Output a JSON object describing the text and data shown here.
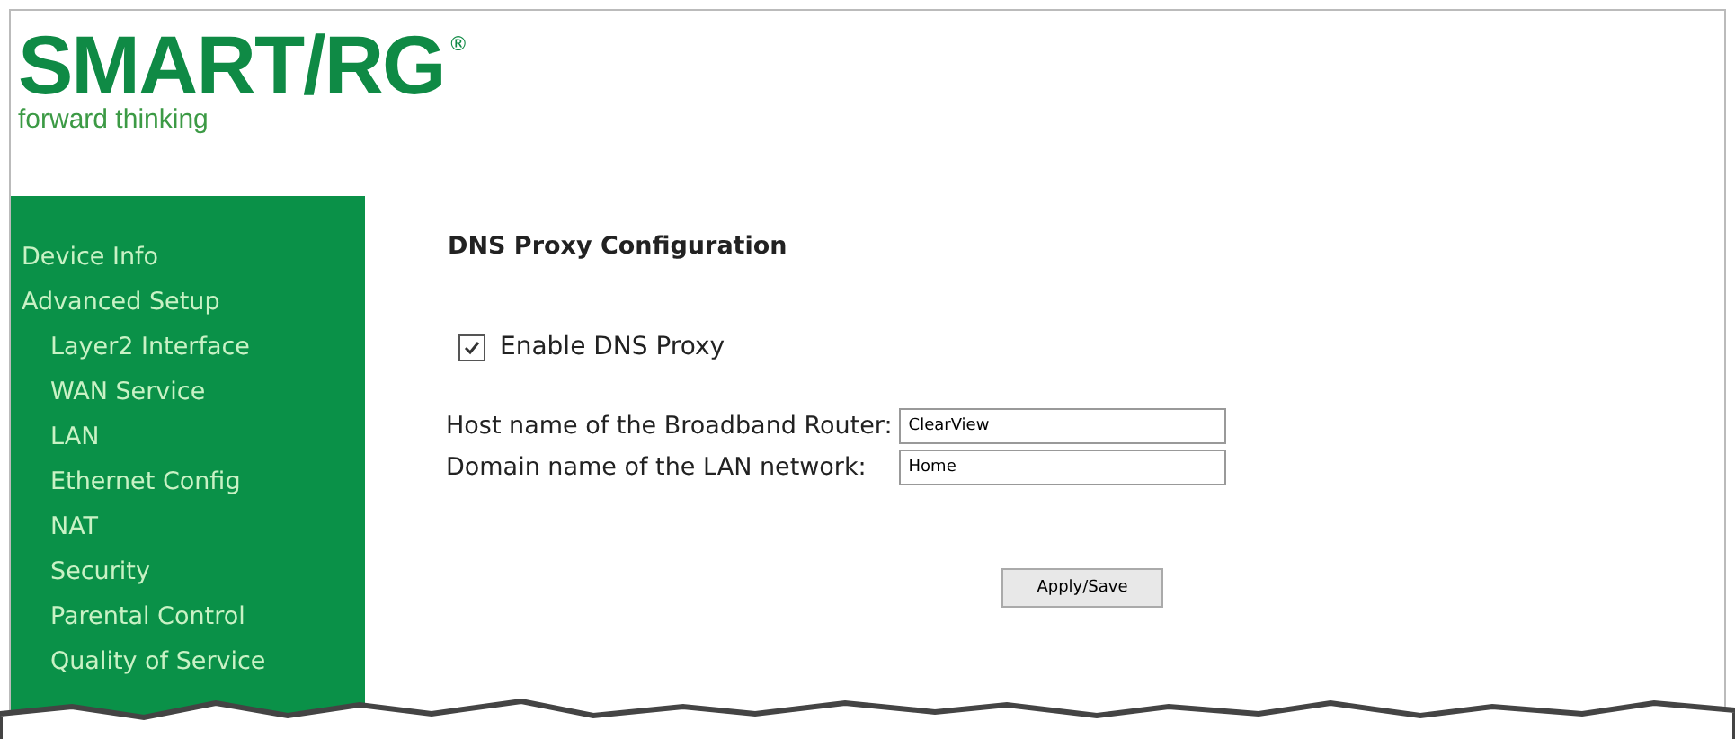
{
  "logo": {
    "brand": "SMART/RG",
    "registered": "®",
    "tagline": "forward thinking"
  },
  "sidebar": {
    "items": [
      {
        "label": "Device Info"
      },
      {
        "label": "Advanced Setup",
        "children": [
          {
            "label": "Layer2 Interface"
          },
          {
            "label": "WAN Service"
          },
          {
            "label": "LAN"
          },
          {
            "label": "Ethernet Config"
          },
          {
            "label": "NAT"
          },
          {
            "label": "Security"
          },
          {
            "label": "Parental Control"
          },
          {
            "label": "Quality of Service"
          }
        ]
      }
    ]
  },
  "content": {
    "title": "DNS Proxy Configuration",
    "enable": {
      "label": "Enable DNS Proxy",
      "checked": true
    },
    "fields": [
      {
        "label": "Host name of the Broadband Router:",
        "value": "ClearView"
      },
      {
        "label": "Domain name of the LAN network:",
        "value": "Home"
      }
    ],
    "button": "Apply/Save"
  }
}
